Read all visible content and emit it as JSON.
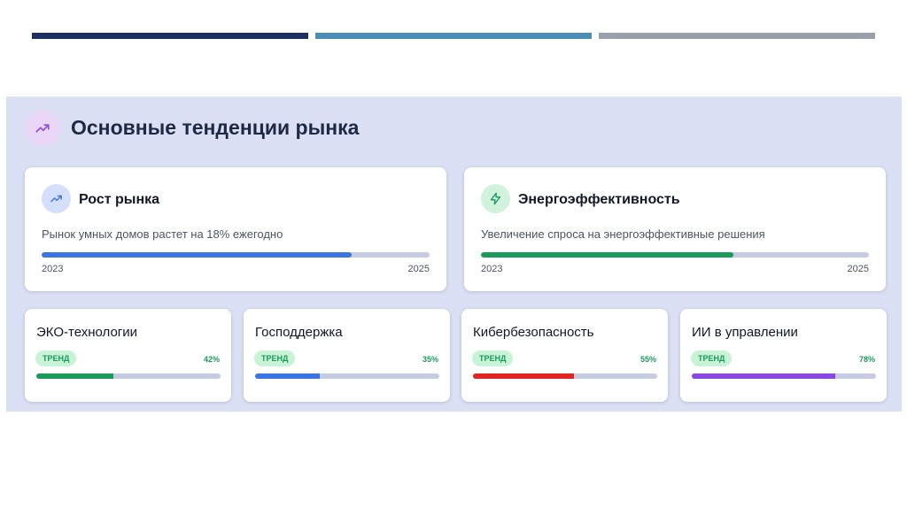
{
  "colors": {
    "bar_navy": "#1d3160",
    "bar_blue": "#4a8db6",
    "bar_gray": "#9aa0ab",
    "panel_bg": "#dbe0f4",
    "track": "#c5cce2",
    "header_icon_bg": "#ead7f8",
    "header_icon_fg": "#8b4fd8",
    "blue": "#3b74e4",
    "blue_icon_bg": "#d4e0fb",
    "green": "#1a9b5c",
    "green_icon_bg": "#d1f2dd",
    "badge_bg": "#c9f3d6",
    "badge_fg": "#1a9b5c",
    "red": "#e02323",
    "purple": "#8a47e6"
  },
  "header": {
    "icon": "trending-up-icon",
    "title": "Основные тенденции рынка"
  },
  "big_cards": [
    {
      "icon": "trending-up-icon",
      "title": "Рост рынка",
      "description": "Рынок умных домов растет на 18% ежегодно",
      "progress": 0.8,
      "start_year": "2023",
      "end_year": "2025"
    },
    {
      "icon": "lightning-icon",
      "title": "Энергоэффективность",
      "description": "Увеличение спроса на энергоэффективные решения",
      "progress": 0.65,
      "start_year": "2023",
      "end_year": "2025"
    }
  ],
  "small_cards": [
    {
      "title": "ЭКО-технологии",
      "badge": "ТРЕНД",
      "percent_label": "42%",
      "progress": 0.42,
      "bar_color": "#1a9b5c"
    },
    {
      "title": "Господдержка",
      "badge": "ТРЕНД",
      "percent_label": "35%",
      "progress": 0.35,
      "bar_color": "#3b74e4"
    },
    {
      "title": "Кибербезопасность",
      "badge": "ТРЕНД",
      "percent_label": "55%",
      "progress": 0.55,
      "bar_color": "#e02323"
    },
    {
      "title": "ИИ в управлении",
      "badge": "ТРЕНД",
      "percent_label": "78%",
      "progress": 0.78,
      "bar_color": "#8a47e6"
    }
  ]
}
